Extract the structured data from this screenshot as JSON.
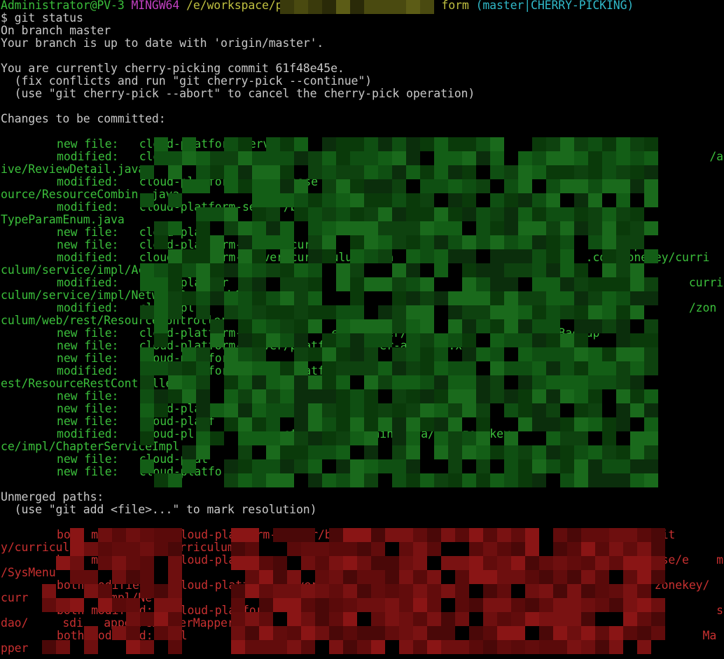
{
  "prompt": {
    "user_host": "Administrator@PV-3",
    "system": "MINGW64",
    "path": "/e/workspace/p",
    "path_tail": "form",
    "branch_state": "(master|CHERRY-PICKING)",
    "command": "$ git status"
  },
  "status": {
    "branch_line": "On branch master",
    "uptodate_line": "Your branch is up to date with 'origin/master'.",
    "cherry_line": "You are currently cherry-picking commit 61f48e45e.",
    "hint_continue": "  (fix conflicts and run \"git cherry-pick --continue\")",
    "hint_abort": "  (use \"git cherry-pick --abort\" to cancel the cherry-pick operation)",
    "changes_header": "Changes to be committed:",
    "unmerged_header": "Unmerged paths:",
    "unmerged_hint": "  (use \"git add <file>...\" to mark resolution)"
  },
  "staged_lines": [
    "new file:   cloud-platform-server/                                    ionsBackup",
    "modified:   cloud-platform-server/base                                         key/base        /act",
    "ive/ReviewDetail.java",
    "modified:   cloud-platform-server/base                                                           es",
    "ource/ResourceCombin .java",
    "modified:   cloud-platform-server/b                                                              ss",
    "TypeParamEnum.java",
    "new file:   cloud-pla                                                          kup",
    "new file:   cloud-platform-server/curr                             .xml.         ckup",
    "modified:   cloud-platform-server/curriculum-mana                            .com/zonekey/curri",
    "culum/service/impl/ActiveSer",
    "modified:   cloud-platfor                         agem                  n/java/com/z        curri",
    "culum/service/impl/NetworkResearchCurr",
    "modified:   cloud-pl                                                                        /zon",
    "culum/web/rest/ResourceController",
    "new file:   cloud-platform-server       eka-server/                  ionsBackup",
    "new file:   cloud-platform-server/platform-server-app/pom.xml.        Backup",
    "new file:   cloud-platfor",
    "modified:   cloud-platform-server/platform                                                       ,r",
    "est/ResourceRestController.",
    "new file:   cloud-pl",
    "new file:   cloud-platf                      ckup",
    "new file:   cloud-platf",
    "modified:   cloud-pl             ettings/src/main/java/com/zonekey                                vi",
    "ce/impl/ChapterServiceImpl.",
    "new file:   cloud-plat",
    "new file:   cloud-platfo                                                       n"
  ],
  "unmerged_lines": [
    "both modified:   cloud-platform-server/base-domain/src/                               ntit",
    "y/curriculumMoveTeachingCurriculum",
    "both modified:   cloud-pla                                                            base/e    ms",
    "/SysMenu         .",
    "both modified:   cloud-platform-server/curricul                                        zonekey/",
    "curr           impl/Ne",
    "both modified:   cloud-platfor                                                                  s/",
    "dao/     sdi   apper/ChapterMapper.java",
    "both modified:   cl                     ettings/                                              Ma",
    "pper        "
  ],
  "colors": {
    "background": "#000000",
    "default_text": "#c0c0c0",
    "prompt_green": "#3bbf3b",
    "prompt_magenta": "#c040c0",
    "prompt_yellow": "#c0c040",
    "prompt_cyan": "#30b8c8",
    "staged_green": "#3bbf3b",
    "unmerged_red": "#c83030"
  }
}
